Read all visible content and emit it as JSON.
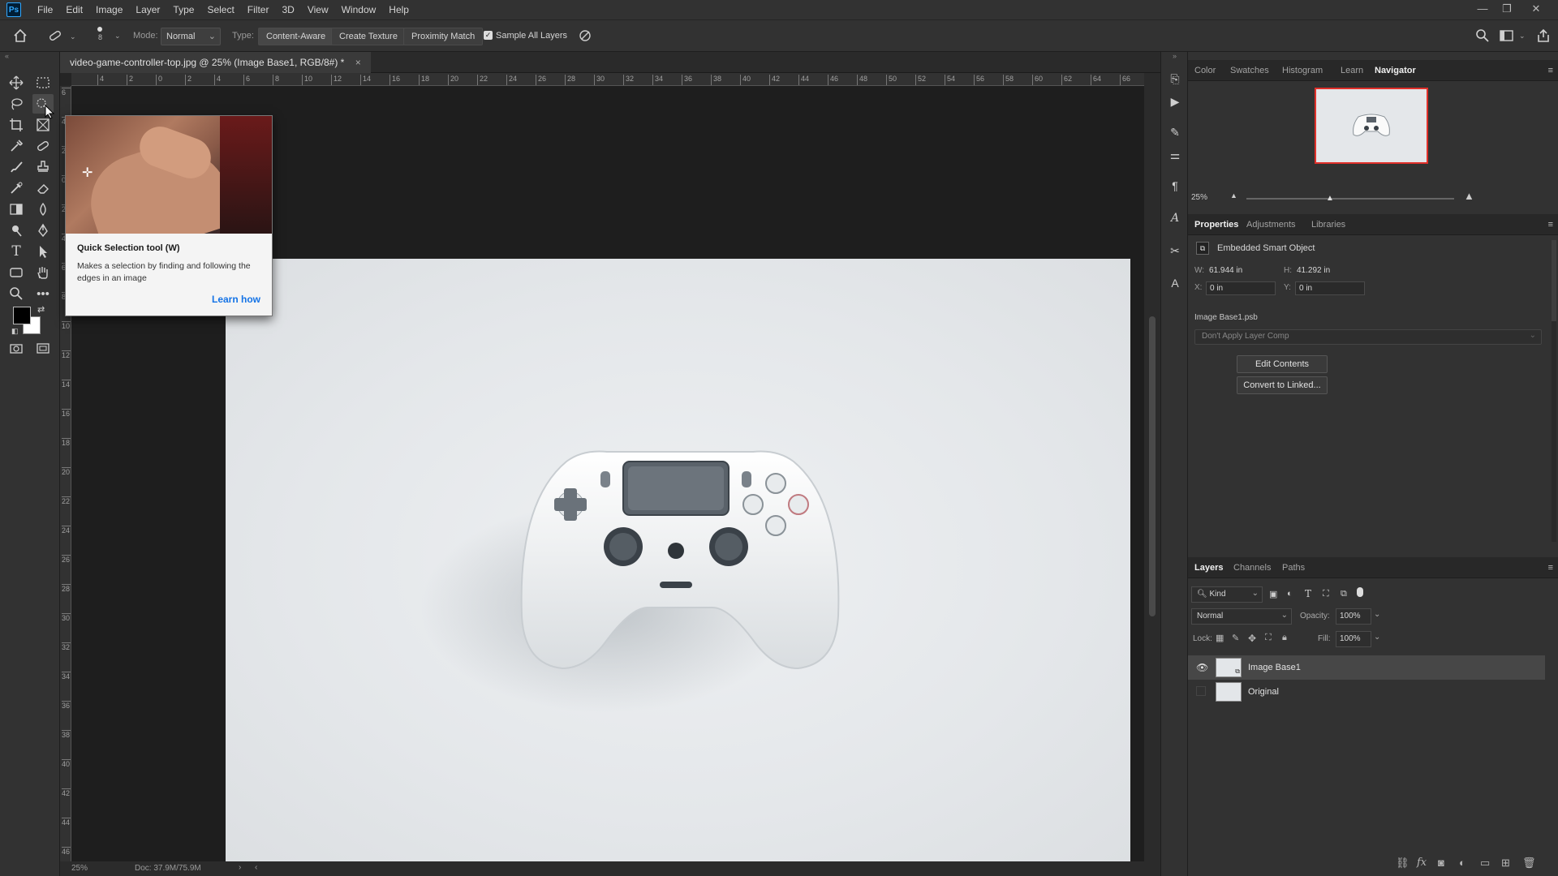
{
  "menubar": {
    "logo": "Ps",
    "items": [
      "File",
      "Edit",
      "Image",
      "Layer",
      "Type",
      "Select",
      "Filter",
      "3D",
      "View",
      "Window",
      "Help"
    ]
  },
  "options": {
    "brush_size": "8",
    "mode_label": "Mode:",
    "mode_value": "Normal",
    "type_label": "Type:",
    "type_buttons": [
      "Content-Aware",
      "Create Texture",
      "Proximity Match"
    ],
    "sample_all_layers": "Sample All Layers"
  },
  "document": {
    "tab_title": "video-game-controller-top.jpg @ 25% (Image Base1, RGB/8#) *",
    "close": "×"
  },
  "ruler_top": [
    "4",
    "2",
    "0",
    "2",
    "4",
    "6",
    "8",
    "10",
    "12",
    "14",
    "16",
    "18",
    "20",
    "22",
    "24",
    "26",
    "28",
    "30",
    "32",
    "34",
    "36",
    "38",
    "40",
    "42",
    "44",
    "46",
    "48",
    "50",
    "52",
    "54",
    "56",
    "58",
    "60",
    "62",
    "64",
    "66"
  ],
  "ruler_left": [
    "6",
    "4",
    "2",
    "0",
    "2",
    "4",
    "6",
    "8",
    "10",
    "12",
    "14",
    "16",
    "18",
    "20",
    "22",
    "24",
    "26",
    "28",
    "30",
    "32",
    "34",
    "36",
    "38",
    "40",
    "42",
    "44",
    "46"
  ],
  "tooltip": {
    "title": "Quick Selection tool (W)",
    "description": "Makes a selection by finding and following the edges in an image",
    "link": "Learn how"
  },
  "statusbar": {
    "zoom": "25%",
    "doc": "Doc: 37.9M/75.9M"
  },
  "navigator": {
    "tabs": [
      "Color",
      "Swatches",
      "Histogram",
      "Learn",
      "Navigator"
    ],
    "active_tab": "Navigator",
    "zoom": "25%"
  },
  "properties": {
    "tabs": [
      "Properties",
      "Adjustments",
      "Libraries"
    ],
    "active_tab": "Properties",
    "object_type": "Embedded Smart Object",
    "w_label": "W:",
    "w_value": "61.944 in",
    "h_label": "H:",
    "h_value": "41.292 in",
    "x_label": "X:",
    "x_value": "0 in",
    "y_label": "Y:",
    "y_value": "0 in",
    "file_name": "Image Base1.psb",
    "layer_comp": "Don't Apply Layer Comp",
    "edit_contents": "Edit Contents",
    "convert_linked": "Convert to Linked..."
  },
  "layers": {
    "tabs": [
      "Layers",
      "Channels",
      "Paths"
    ],
    "active_tab": "Layers",
    "filter_kind": "Kind",
    "blend_mode": "Normal",
    "opacity_label": "Opacity:",
    "opacity_value": "100%",
    "lock_label": "Lock:",
    "fill_label": "Fill:",
    "fill_value": "100%",
    "items": [
      {
        "name": "Image Base1",
        "visible": true,
        "selected": true
      },
      {
        "name": "Original",
        "visible": false,
        "selected": false
      }
    ]
  },
  "colors": {
    "accent": "#1473e6",
    "ps_blue": "#31a8ff",
    "nav_highlight": "#e0302a"
  }
}
